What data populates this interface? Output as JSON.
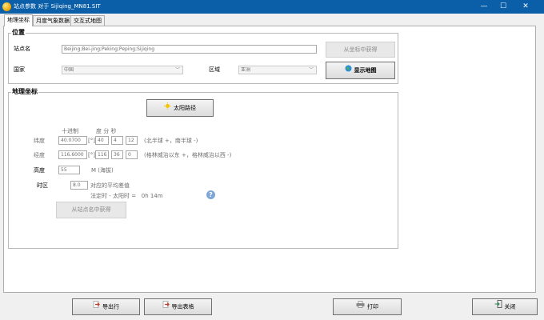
{
  "window": {
    "title": "站点参数 对于 Sijiqing_MN81.SIT",
    "minimize_glyph": "—",
    "maximize_glyph": "☐",
    "close_glyph": "✕"
  },
  "tabs": [
    {
      "label": "地理坐标",
      "active": true
    },
    {
      "label": "月度气象数据",
      "active": false
    },
    {
      "label": "交互式地图",
      "active": false
    }
  ],
  "location": {
    "group_title": "位置",
    "site_name_label": "站点名",
    "site_name_value": "Beijing;Bei-jing;Peking;Peping;Sijiqing",
    "get_from_coords_button": "从坐标中获得",
    "country_label": "国家",
    "country_value": "中国",
    "region_label": "区域",
    "region_value": "亚洲",
    "show_map_button": "显示地图"
  },
  "geo": {
    "group_title": "地理坐标",
    "sun_path_button": "太阳路径",
    "header_decimal": "十进制",
    "header_dms": "度 分 秒",
    "latitude_label": "纬度",
    "latitude_decimal": "40.0700",
    "latitude_unit": "[°]",
    "latitude_deg": "40",
    "latitude_min": "4",
    "latitude_sec": "12",
    "latitude_hint": "(北半球 +，南半球 -)",
    "longitude_label": "经度",
    "longitude_decimal": "116.6000",
    "longitude_unit": "[°]",
    "longitude_deg": "116",
    "longitude_min": "36",
    "longitude_sec": "0",
    "longitude_hint": "(格林威治以东 +，格林威治以西 -)",
    "altitude_label": "高度",
    "altitude_value": "55",
    "altitude_unit": "M (海拔)",
    "timezone_label": "时区",
    "timezone_value": "8.0",
    "timezone_hint": "对应的平均差值",
    "legal_solar_text": "法定时 - 太阳时 =   0h 14m",
    "get_from_site_button": "从站点名中获得"
  },
  "footer": {
    "export_row_button": "导出行",
    "export_table_button": "导出表格",
    "print_button": "打印",
    "close_button": "关闭"
  },
  "colors": {
    "titlebar": "#0b5fa8",
    "export_icon": "#c0392b",
    "sun_icon": "#f5c400"
  }
}
